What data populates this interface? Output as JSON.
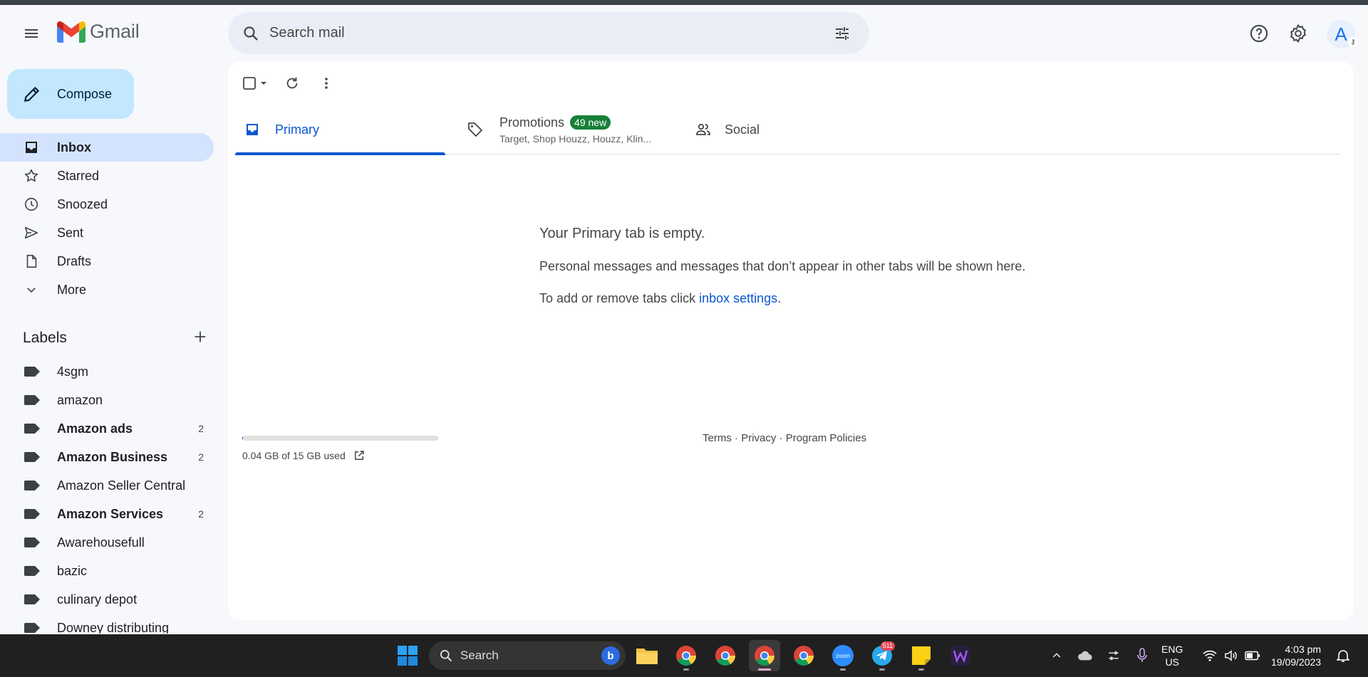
{
  "app": {
    "name": "Gmail"
  },
  "search": {
    "placeholder": "Search mail"
  },
  "header": {
    "avatar_initial": "A"
  },
  "compose": {
    "label": "Compose"
  },
  "nav": [
    {
      "label": "Inbox",
      "icon": "inbox-icon",
      "active": true
    },
    {
      "label": "Starred",
      "icon": "star-icon"
    },
    {
      "label": "Snoozed",
      "icon": "clock-icon"
    },
    {
      "label": "Sent",
      "icon": "send-icon"
    },
    {
      "label": "Drafts",
      "icon": "draft-icon"
    },
    {
      "label": "More",
      "icon": "chevron-down-icon"
    }
  ],
  "labels": {
    "title": "Labels",
    "items": [
      {
        "name": "4sgm",
        "count": ""
      },
      {
        "name": "amazon",
        "count": ""
      },
      {
        "name": "Amazon ads",
        "count": "2",
        "bold": true
      },
      {
        "name": "Amazon Business",
        "count": "2",
        "bold": true
      },
      {
        "name": "Amazon Seller Central",
        "count": ""
      },
      {
        "name": "Amazon Services",
        "count": "2",
        "bold": true
      },
      {
        "name": "Awarehousefull",
        "count": ""
      },
      {
        "name": "bazic",
        "count": ""
      },
      {
        "name": "culinary depot",
        "count": ""
      },
      {
        "name": "Downey distributing",
        "count": ""
      }
    ]
  },
  "tabs": {
    "primary": "Primary",
    "promotions": "Promotions",
    "promotions_badge": "49 new",
    "promotions_senders": "Target, Shop Houzz, Houzz, Klin...",
    "social": "Social"
  },
  "empty_state": {
    "heading": "Your Primary tab is empty.",
    "line1": "Personal messages and messages that don’t appear in other tabs will be shown here.",
    "line2_prefix": "To add or remove tabs click ",
    "line2_link": "inbox settings",
    "line2_suffix": "."
  },
  "storage": {
    "text": "0.04 GB of 15 GB used",
    "used_fraction": 0.003
  },
  "footer": {
    "terms": "Terms",
    "privacy": "Privacy",
    "policies": "Program Policies",
    "sep": " · "
  },
  "taskbar": {
    "search": "Search",
    "lang1": "ENG",
    "lang2": "US",
    "time": "4:03 pm",
    "date": "19/09/2023",
    "telegram_badge": "511",
    "zoom_label": "zoom"
  },
  "colors": {
    "accent": "#0b57d0",
    "compose_bg": "#c2e7ff",
    "active_nav": "#d3e3fd",
    "badge_green": "#188038"
  }
}
